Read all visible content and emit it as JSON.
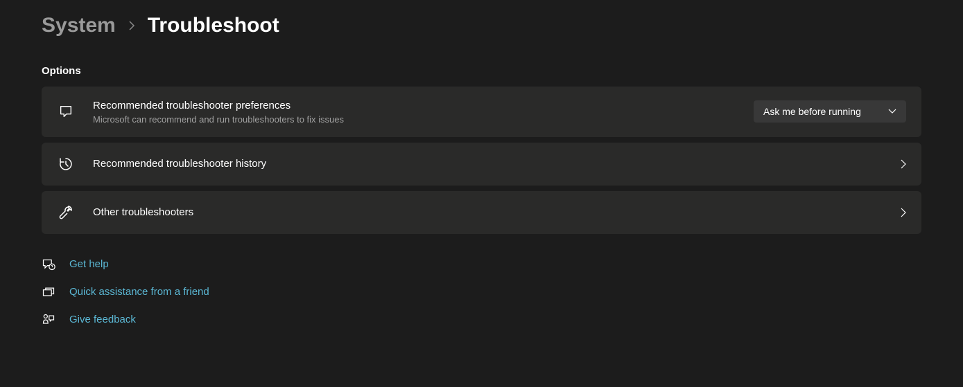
{
  "breadcrumb": {
    "parent": "System",
    "current": "Troubleshoot"
  },
  "section": {
    "label": "Options"
  },
  "cards": {
    "preferences": {
      "title": "Recommended troubleshooter preferences",
      "subtitle": "Microsoft can recommend and run troubleshooters to fix issues",
      "dropdown": "Ask me before running"
    },
    "history": {
      "title": "Recommended troubleshooter history"
    },
    "other": {
      "title": "Other troubleshooters"
    }
  },
  "links": {
    "help": "Get help",
    "quick": "Quick assistance from a friend",
    "feedback": "Give feedback"
  }
}
